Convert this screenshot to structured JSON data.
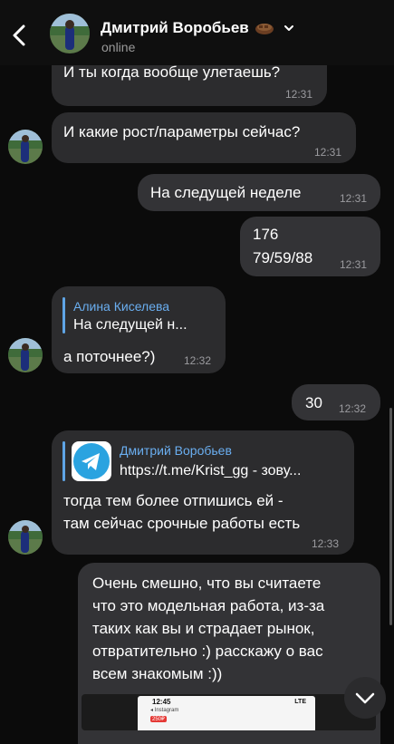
{
  "header": {
    "contact_name": "Дмитрий Воробьев",
    "status": "online"
  },
  "messages": [
    {
      "text": "И ты когда вообще улетаешь?",
      "time": "12:31"
    },
    {
      "text": "И какие рост/параметры сейчас?",
      "time": "12:31"
    },
    {
      "text": "На следущей неделе",
      "time": "12:31"
    },
    {
      "line1": "176",
      "line2": "79/59/88",
      "time": "12:31"
    },
    {
      "reply_name": "Алина Киселева",
      "reply_text": "На следущей н...",
      "text": "а поточнее?)",
      "time": "12:32"
    },
    {
      "text": "30",
      "time": "12:32"
    },
    {
      "reply_name": "Дмитрий Воробьев",
      "reply_text": "https://t.me/Krist_gg - зову...",
      "line1": "тогда тем более отпишись ей -",
      "line2": "там сейчас срочные работы есть",
      "time": "12:33"
    },
    {
      "lines": [
        "Очень смешно, что вы считаете",
        "что это модельная работа, из-за",
        "таких как вы и страдает рынок,",
        "отвратительно :) расскажу о вас",
        "всем знакомым :))"
      ],
      "preview": {
        "time": "12:45",
        "app": "◂ Instagram",
        "badge": "250₽",
        "network": "LTE"
      }
    }
  ],
  "colors": {
    "background": "#0b0b0b",
    "incoming_bubble": "#2c2c2e",
    "outgoing_bubble": "#333336",
    "reply_accent": "#6aaef0",
    "timestamp": "#9b9b9f"
  }
}
